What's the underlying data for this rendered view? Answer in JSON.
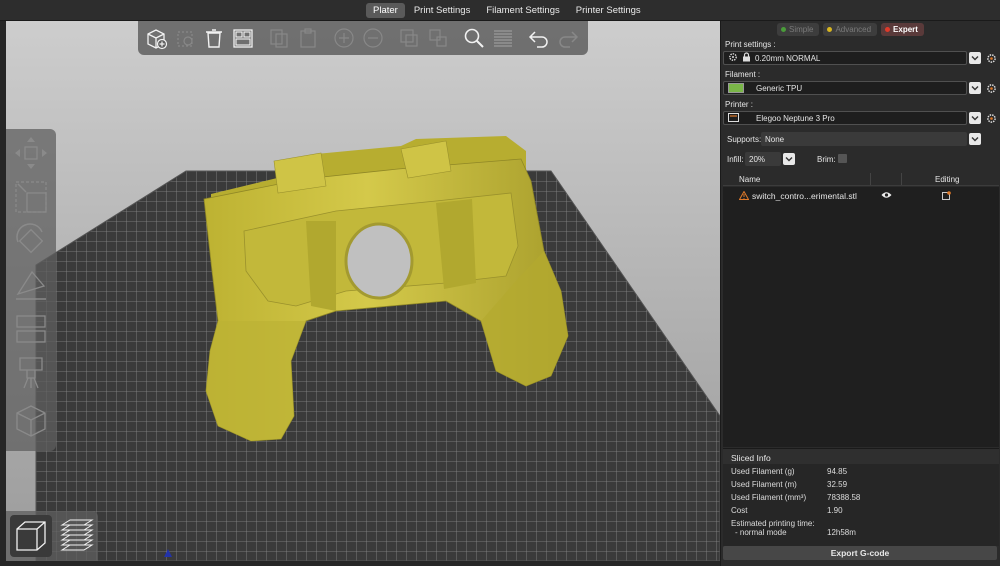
{
  "tabs": [
    "Plater",
    "Print Settings",
    "Filament Settings",
    "Printer Settings"
  ],
  "mode": {
    "simple": "Simple",
    "advanced": "Advanced",
    "expert": "Expert"
  },
  "print_settings": {
    "label": "Print settings :",
    "value": "0.20mm NORMAL"
  },
  "filament": {
    "label": "Filament :",
    "value": "Generic TPU",
    "color": "#7ab648"
  },
  "printer": {
    "label": "Printer :",
    "value": "Elegoo Neptune 3 Pro"
  },
  "supports": {
    "label": "Supports:",
    "value": "None"
  },
  "infill": {
    "label": "Infill:",
    "value": "20%"
  },
  "brim": {
    "label": "Brim:"
  },
  "object_list": {
    "col_name": "Name",
    "col_editing": "Editing",
    "items": [
      {
        "name": "switch_contro...erimental.stl",
        "warning": true
      }
    ]
  },
  "sliced_info": {
    "title": "Sliced Info",
    "rows": [
      {
        "label": "Used Filament (g)",
        "value": "94.85"
      },
      {
        "label": "Used Filament (m)",
        "value": "32.59"
      },
      {
        "label": "Used Filament (mm³)",
        "value": "78388.58"
      },
      {
        "label": "Cost",
        "value": "1.90"
      }
    ],
    "time_label": "Estimated printing time:",
    "time_mode": "- normal mode",
    "time_value": "12h58m"
  },
  "export_label": "Export G-code",
  "model_color": "#c8bd3a",
  "icons": [
    "add-object-icon",
    "delete-icon",
    "delete-all-icon",
    "arrange-icon",
    "copy-icon",
    "paste-icon",
    "add-instance-icon",
    "remove-instance-icon",
    "split-objects-icon",
    "split-parts-icon",
    "search-icon",
    "layers-editing-icon",
    "undo-icon",
    "redo-icon",
    "move-icon",
    "scale-icon",
    "rotate-icon",
    "place-on-face-icon",
    "cut-icon",
    "paint-supports-icon",
    "seam-painting-icon",
    "3d-view-icon",
    "preview-icon"
  ]
}
